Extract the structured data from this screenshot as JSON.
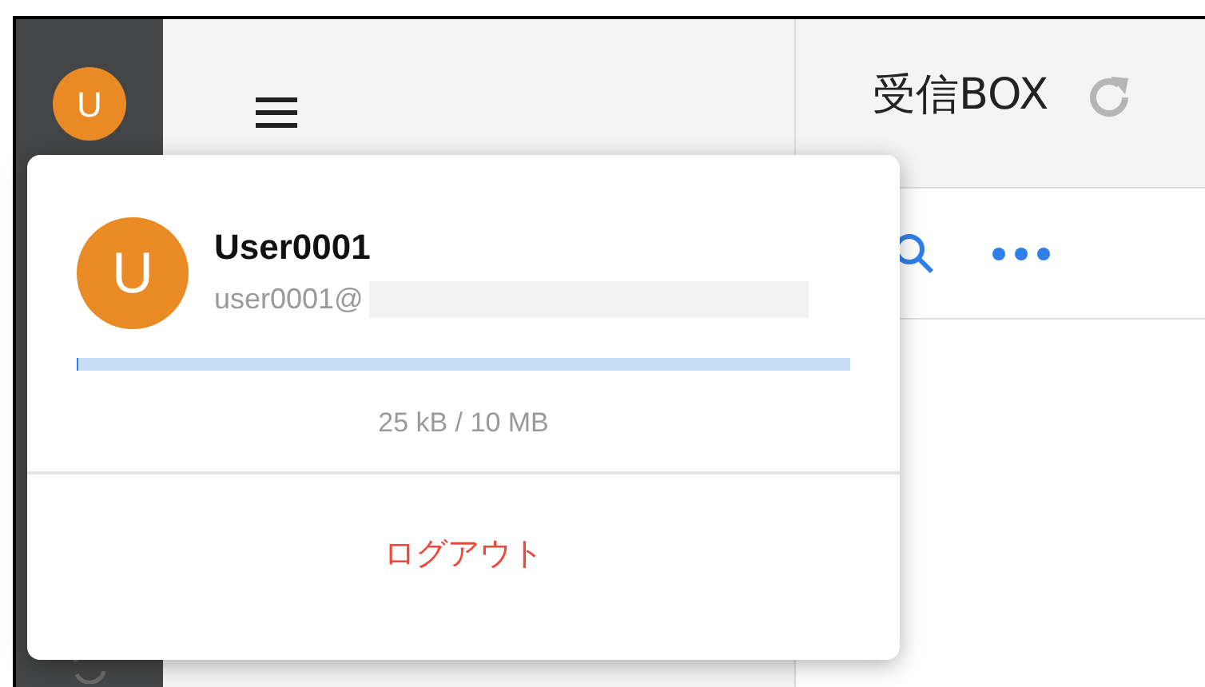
{
  "sidebar": {
    "avatar_letter": "U"
  },
  "inbox": {
    "title": "受信BOX"
  },
  "account_menu": {
    "avatar_letter": "U",
    "user_name": "User0001",
    "email": "user0001@",
    "storage": {
      "level": 0.0025,
      "reading": "25 kB / 10 MB"
    },
    "logout": "ログアウト"
  }
}
